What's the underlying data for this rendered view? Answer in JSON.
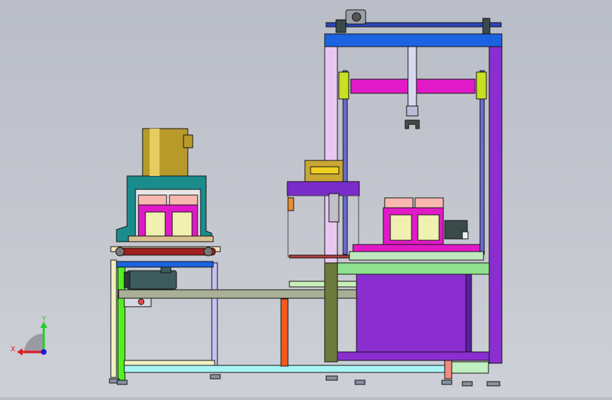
{
  "axes_triad": {
    "x_label": "X",
    "y_label": "Y",
    "x_color": "#e8141e",
    "y_color": "#1fd21f",
    "z_color": "#1c1cd6"
  },
  "palette": {
    "background": "#c3c6ce",
    "frame_blue": "#1b63e0",
    "frame_purple": "#8a2ed0",
    "magenta": "#e11ac8",
    "teal": "#1b8c8c",
    "gold": "#c8a832",
    "green": "#8fe08f",
    "olive": "#6e7a3c",
    "cyan": "#a8f4f6",
    "salmon": "#f08a7e",
    "orange": "#f25a1c",
    "yellow_green": "#55ee22",
    "lavender": "#e8c8f0",
    "pink_light": "#f8b8b0",
    "cream": "#f0f0c0",
    "dark_grey": "#3a4a4a"
  }
}
